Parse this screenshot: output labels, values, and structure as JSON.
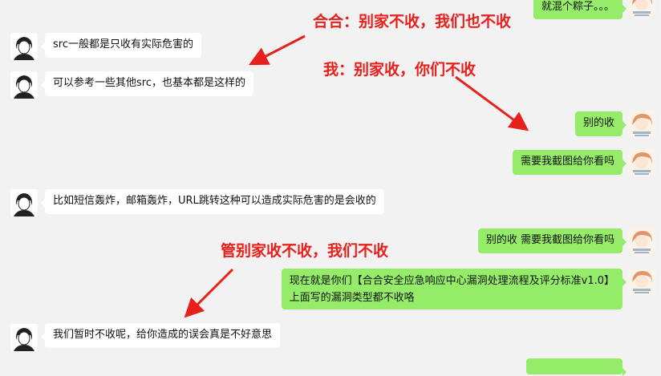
{
  "messages": {
    "m0": "就混个粽子。。。",
    "m1": "src一般都是只收有实际危害的",
    "m2": "可以参考一些其他src，也基本都是这样的",
    "m3": "别的收",
    "m4": "需要我截图给你看吗",
    "m5": "比如短信轰炸，邮箱轰炸，URL跳转这种可以造成实际危害的是会收的",
    "m6": "别的收 需要我截图给你看吗",
    "m7_line1": "现在就是你们【合合安全应急响应中心漏洞处理流程及评分标准v1.0】",
    "m7_line2": "上面写的漏洞类型都不收咯",
    "m8": "我们暂时不收呢，给你造成的误会真是不好意思"
  },
  "annotations": {
    "a1": "合合：别家不收，我们也不收",
    "a2": "我：别家收，你们不收",
    "a3": "管别家收不收，我们不收"
  },
  "colors": {
    "background": "#f2f2f2",
    "incoming_bubble": "#ffffff",
    "outgoing_bubble": "#95ec69",
    "annotation_red": "#e8201c"
  },
  "icons": {
    "contact_avatar": "male-outline-avatar-icon",
    "self_avatar": "anime-girl-avatar-icon"
  }
}
